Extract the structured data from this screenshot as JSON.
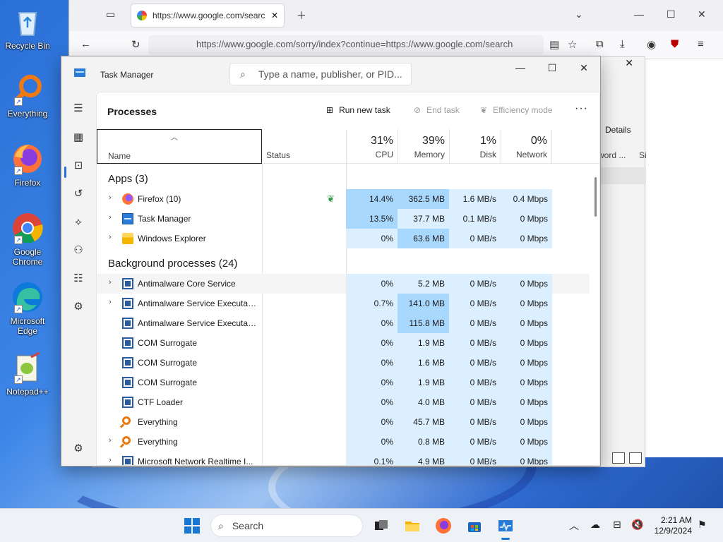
{
  "desktop": {
    "icons": [
      {
        "label": "Recycle Bin",
        "icon": "recycle-bin-icon"
      },
      {
        "label": "Everything",
        "icon": "everything-icon"
      },
      {
        "label": "Firefox",
        "icon": "firefox-icon"
      },
      {
        "label": "Google Chrome",
        "icon": "chrome-icon"
      },
      {
        "label": "Microsoft Edge",
        "icon": "edge-icon"
      },
      {
        "label": "Notepad++",
        "icon": "notepadpp-icon"
      }
    ]
  },
  "browser": {
    "tab_url": "https://www.google.com/searc",
    "address": "https://www.google.com/sorry/index?continue=https://www.google.com/search"
  },
  "background_window": {
    "details_label": "Details",
    "col_word": "word ...",
    "col_si": "Si"
  },
  "task_manager": {
    "title": "Task Manager",
    "search_placeholder": "Type a name, publisher, or PID...",
    "page_title": "Processes",
    "toolbar": {
      "run_new_task": "Run new task",
      "end_task": "End task",
      "efficiency_mode": "Efficiency mode"
    },
    "columns": {
      "name": "Name",
      "status": "Status",
      "cpu": {
        "pct": "31%",
        "label": "CPU"
      },
      "memory": {
        "pct": "39%",
        "label": "Memory"
      },
      "disk": {
        "pct": "1%",
        "label": "Disk"
      },
      "network": {
        "pct": "0%",
        "label": "Network"
      }
    },
    "groups": [
      {
        "title": "Apps (3)",
        "rows": [
          {
            "name": "Firefox (10)",
            "icon": "firefox",
            "expand": true,
            "eco": true,
            "cpu": "14.4%",
            "mem": "362.5 MB",
            "disk": "1.6 MB/s",
            "net": "0.4 Mbps",
            "cpu_heat": 2,
            "mem_heat": 2,
            "disk_heat": 1,
            "net_heat": 1
          },
          {
            "name": "Task Manager",
            "icon": "taskmgr",
            "expand": true,
            "eco": false,
            "cpu": "13.5%",
            "mem": "37.7 MB",
            "disk": "0.1 MB/s",
            "net": "0 Mbps",
            "cpu_heat": 2,
            "mem_heat": 1,
            "disk_heat": 1,
            "net_heat": 1
          },
          {
            "name": "Windows Explorer",
            "icon": "folder",
            "expand": true,
            "eco": false,
            "cpu": "0%",
            "mem": "63.6 MB",
            "disk": "0 MB/s",
            "net": "0 Mbps",
            "cpu_heat": 1,
            "mem_heat": 2,
            "disk_heat": 1,
            "net_heat": 1
          }
        ]
      },
      {
        "title": "Background processes (24)",
        "rows": [
          {
            "name": "Antimalware Core Service",
            "icon": "svc",
            "expand": true,
            "eco": false,
            "cpu": "0%",
            "mem": "5.2 MB",
            "disk": "0 MB/s",
            "net": "0 Mbps",
            "cpu_heat": 1,
            "mem_heat": 1,
            "disk_heat": 1,
            "net_heat": 1,
            "hover": true
          },
          {
            "name": "Antimalware Service Executable",
            "icon": "svc",
            "expand": true,
            "eco": false,
            "cpu": "0.7%",
            "mem": "141.0 MB",
            "disk": "0 MB/s",
            "net": "0 Mbps",
            "cpu_heat": 1,
            "mem_heat": 2,
            "disk_heat": 1,
            "net_heat": 1
          },
          {
            "name": "Antimalware Service Executabl...",
            "icon": "svc",
            "expand": false,
            "eco": false,
            "cpu": "0%",
            "mem": "115.8 MB",
            "disk": "0 MB/s",
            "net": "0 Mbps",
            "cpu_heat": 1,
            "mem_heat": 2,
            "disk_heat": 1,
            "net_heat": 1
          },
          {
            "name": "COM Surrogate",
            "icon": "svc",
            "expand": false,
            "eco": false,
            "cpu": "0%",
            "mem": "1.9 MB",
            "disk": "0 MB/s",
            "net": "0 Mbps",
            "cpu_heat": 1,
            "mem_heat": 1,
            "disk_heat": 1,
            "net_heat": 1
          },
          {
            "name": "COM Surrogate",
            "icon": "svc",
            "expand": false,
            "eco": false,
            "cpu": "0%",
            "mem": "1.6 MB",
            "disk": "0 MB/s",
            "net": "0 Mbps",
            "cpu_heat": 1,
            "mem_heat": 1,
            "disk_heat": 1,
            "net_heat": 1
          },
          {
            "name": "COM Surrogate",
            "icon": "svc",
            "expand": false,
            "eco": false,
            "cpu": "0%",
            "mem": "1.9 MB",
            "disk": "0 MB/s",
            "net": "0 Mbps",
            "cpu_heat": 1,
            "mem_heat": 1,
            "disk_heat": 1,
            "net_heat": 1
          },
          {
            "name": "CTF Loader",
            "icon": "svc",
            "expand": false,
            "eco": false,
            "cpu": "0%",
            "mem": "4.0 MB",
            "disk": "0 MB/s",
            "net": "0 Mbps",
            "cpu_heat": 1,
            "mem_heat": 1,
            "disk_heat": 1,
            "net_heat": 1
          },
          {
            "name": "Everything",
            "icon": "everything",
            "expand": false,
            "eco": false,
            "cpu": "0%",
            "mem": "45.7 MB",
            "disk": "0 MB/s",
            "net": "0 Mbps",
            "cpu_heat": 1,
            "mem_heat": 1,
            "disk_heat": 1,
            "net_heat": 1
          },
          {
            "name": "Everything",
            "icon": "everything",
            "expand": true,
            "eco": false,
            "cpu": "0%",
            "mem": "0.8 MB",
            "disk": "0 MB/s",
            "net": "0 Mbps",
            "cpu_heat": 1,
            "mem_heat": 1,
            "disk_heat": 1,
            "net_heat": 1
          },
          {
            "name": "Microsoft Network Realtime I...",
            "icon": "svc",
            "expand": true,
            "eco": false,
            "cpu": "0.1%",
            "mem": "4.9 MB",
            "disk": "0 MB/s",
            "net": "0 Mbps",
            "cpu_heat": 1,
            "mem_heat": 1,
            "disk_heat": 1,
            "net_heat": 1
          }
        ]
      }
    ],
    "heat_colors": {
      "1": "#dcefff",
      "2": "#a9d8ff"
    }
  },
  "taskbar": {
    "search_placeholder": "Search",
    "time": "2:21 AM",
    "date": "12/9/2024"
  }
}
